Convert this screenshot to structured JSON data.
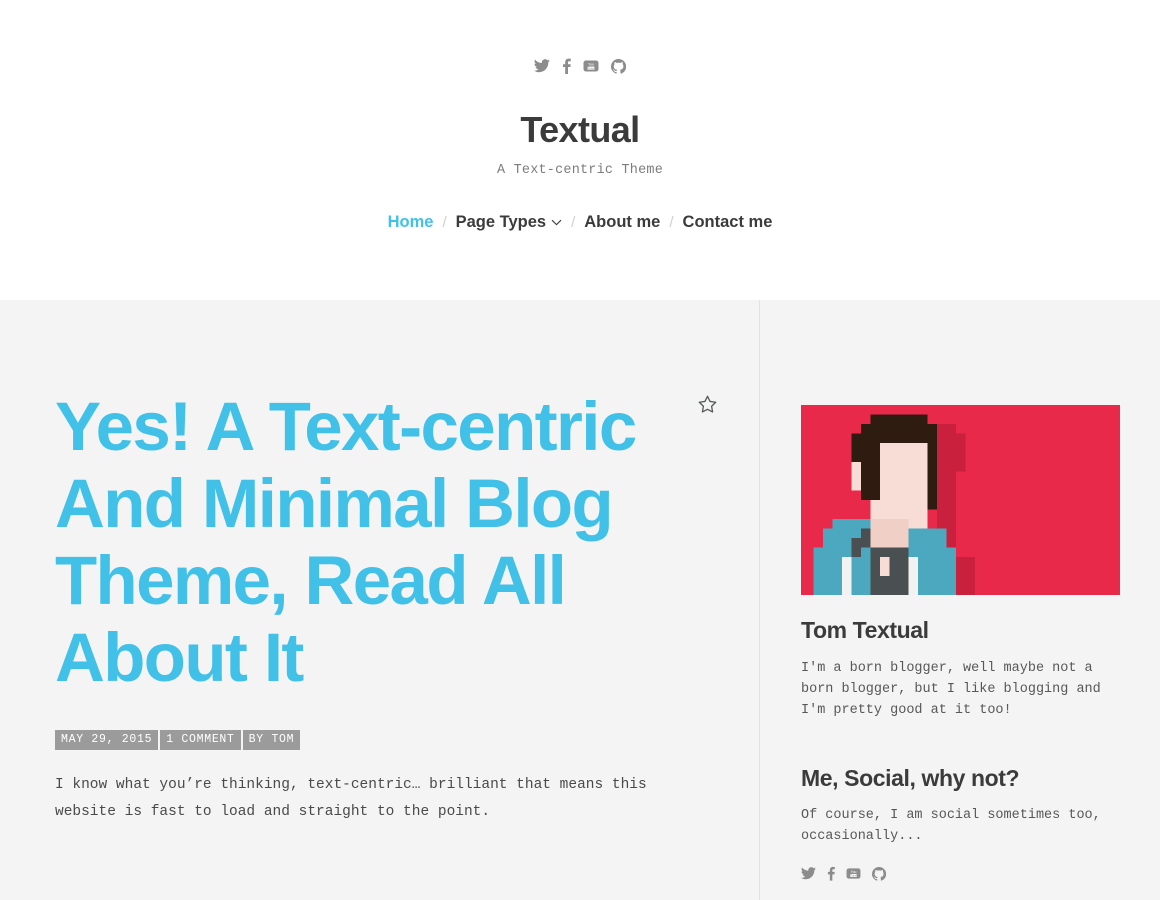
{
  "header": {
    "title": "Textual",
    "tagline": "A Text-centric Theme",
    "social": [
      {
        "name": "twitter-icon",
        "label": "Twitter"
      },
      {
        "name": "facebook-icon",
        "label": "Facebook"
      },
      {
        "name": "youtube-icon",
        "label": "YouTube"
      },
      {
        "name": "github-icon",
        "label": "GitHub"
      }
    ],
    "nav": [
      {
        "label": "Home",
        "active": true,
        "dropdown": false
      },
      {
        "label": "Page Types",
        "active": false,
        "dropdown": true
      },
      {
        "label": "About me",
        "active": false,
        "dropdown": false
      },
      {
        "label": "Contact me",
        "active": false,
        "dropdown": false
      }
    ],
    "nav_separator": "/"
  },
  "post": {
    "title": "Yes! A Text-centric And Minimal Blog Theme, Read All About It",
    "meta": {
      "date": "MAY 29, 2015",
      "comments": "1 COMMENT",
      "author": "BY TOM"
    },
    "excerpt": "I know what you’re thinking, text-centric… brilliant that means this website is fast to load and straight to the point.",
    "bookmark_icon": "star-icon"
  },
  "sidebar": {
    "avatar": {
      "name": "pixel-art-avatar",
      "background": "#E8294A",
      "hair": "#2E1C10",
      "skin": "#F7DDD6",
      "jacket": "#4BA8BE",
      "shirt": "#4A4F52",
      "shadow": "#C9203D"
    },
    "widgets": [
      {
        "title": "Tom Textual",
        "text": "I'm a born blogger, well maybe not a born blogger, but I like blogging and I'm pretty good at it too!"
      },
      {
        "title": "Me, Social, why not?",
        "text": "Of course, I am social sometimes too, occasionally..."
      }
    ],
    "social": [
      {
        "name": "twitter-icon",
        "label": "Twitter"
      },
      {
        "name": "facebook-icon",
        "label": "Facebook"
      },
      {
        "name": "youtube-icon",
        "label": "YouTube"
      },
      {
        "name": "github-icon",
        "label": "GitHub"
      }
    ]
  },
  "colors": {
    "accent": "#41C0E8",
    "ink": "#3b3b3b",
    "body_bg": "#f4f4f4",
    "badge_bg": "#9b9b9b",
    "divider": "#e1e1e1"
  }
}
